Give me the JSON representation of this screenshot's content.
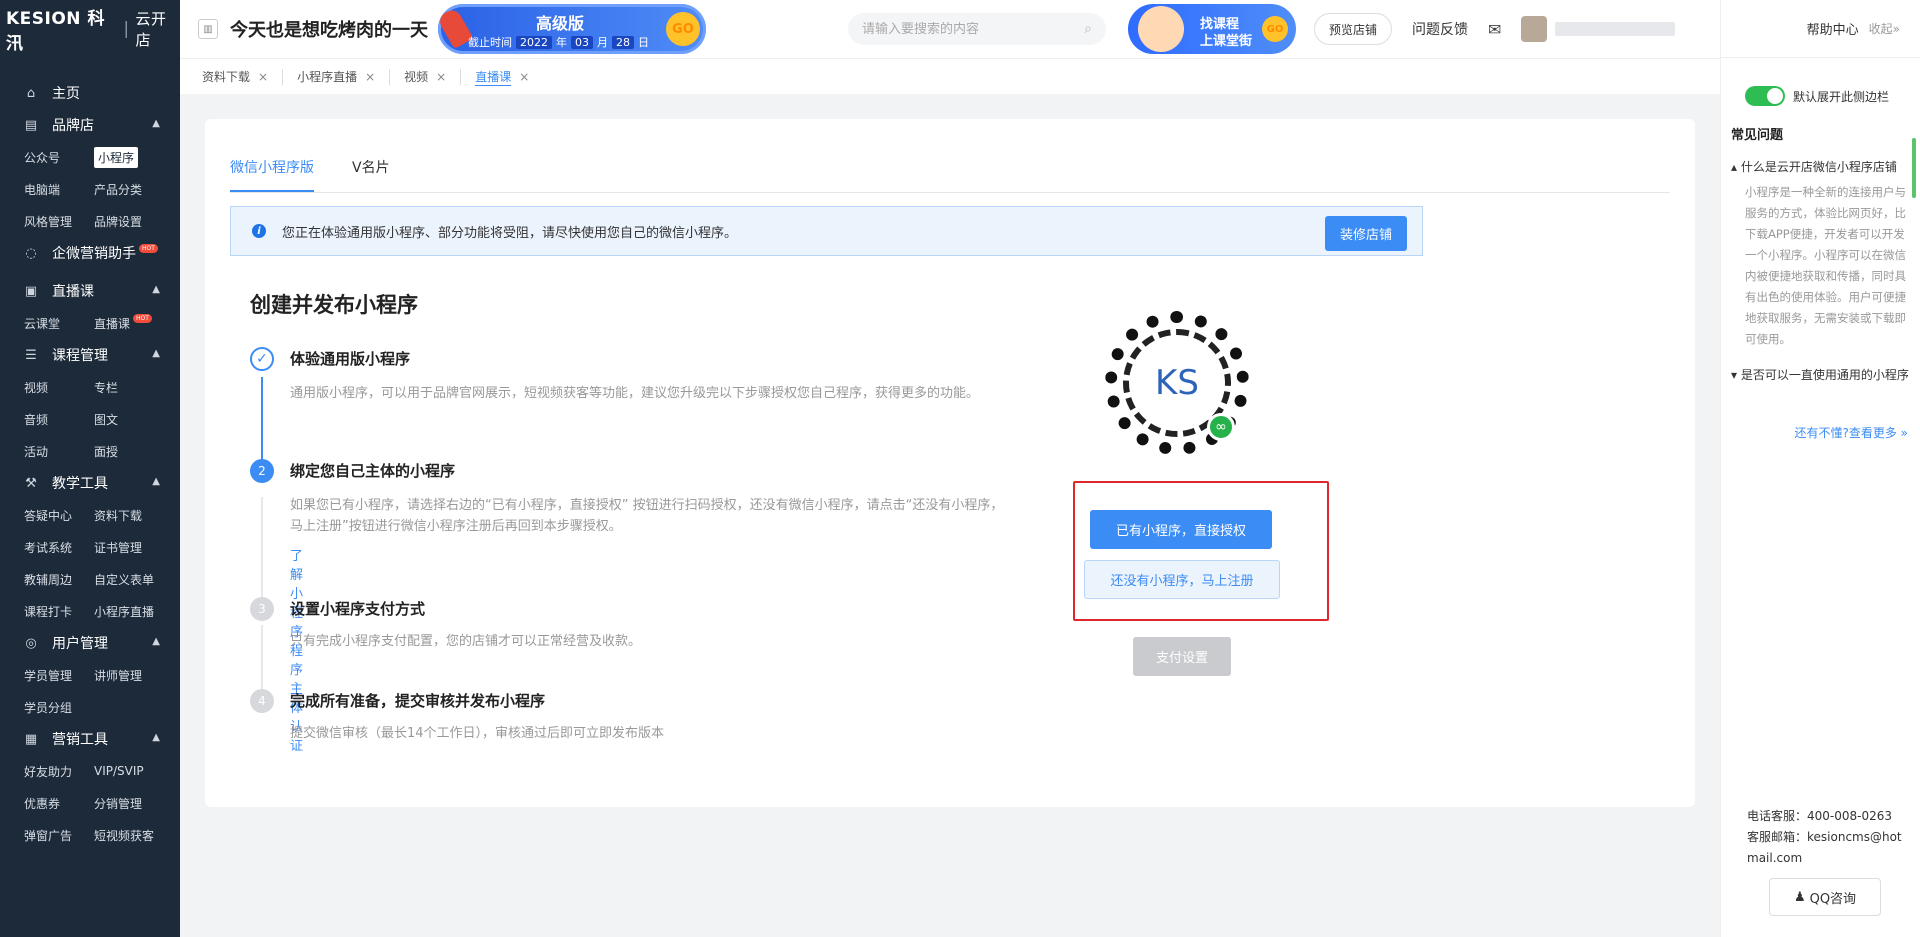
{
  "app": {
    "logo_brand": "KESION 科汛",
    "logo_sep": "|",
    "logo_sub": "云开店"
  },
  "sidebar": {
    "home": "主页",
    "sections": [
      {
        "label": "品牌店",
        "icon": "store-icon",
        "items": [
          "公众号",
          "小程序",
          "电脑端",
          "产品分类",
          "风格管理",
          "品牌设置"
        ]
      },
      {
        "label": "企微营销助手",
        "icon": "chat-icon",
        "hot": "HOT",
        "items": []
      },
      {
        "label": "直播课",
        "icon": "live-icon",
        "items": [
          "云课堂",
          "直播课"
        ],
        "hot_item": "HOT"
      },
      {
        "label": "课程管理",
        "icon": "course-icon",
        "items": [
          "视频",
          "专栏",
          "音频",
          "图文",
          "活动",
          "面授"
        ]
      },
      {
        "label": "教学工具",
        "icon": "tools-icon",
        "items": [
          "答疑中心",
          "资料下载",
          "考试系统",
          "证书管理",
          "教辅周边",
          "自定义表单",
          "课程打卡",
          "小程序直播"
        ]
      },
      {
        "label": "用户管理",
        "icon": "user-icon",
        "items": [
          "学员管理",
          "讲师管理",
          "学员分组"
        ]
      },
      {
        "label": "营销工具",
        "icon": "gift-icon",
        "items": [
          "好友助力",
          "VIP/SVIP",
          "优惠券",
          "分销管理",
          "弹窗广告",
          "短视频获客"
        ]
      }
    ]
  },
  "topbar": {
    "shop_name": "今天也是想吃烤肉的一天",
    "vip": {
      "title": "高级版",
      "deadline_label": "截止时间",
      "year": "2022",
      "year_unit": "年",
      "month": "03",
      "month_unit": "月",
      "day": "28",
      "day_unit": "日",
      "go": "GO"
    },
    "search_placeholder": "请输入要搜索的内容",
    "course_banner": {
      "line1": "找课程",
      "line2": "上课堂街",
      "go": "GO"
    },
    "preview_label": "预览店铺",
    "feedback_label": "问题反馈"
  },
  "tabs": [
    {
      "label": "资料下载",
      "active": false
    },
    {
      "label": "小程序直播",
      "active": false
    },
    {
      "label": "视频",
      "active": false
    },
    {
      "label": "直播课",
      "active": true
    }
  ],
  "main": {
    "inner_tabs": [
      "微信小程序版",
      "V名片"
    ],
    "notice_text": "您正在体验通用版小程序、部分功能将受阻，请尽快使用您自己的微信小程序。",
    "notice_button": "装修店铺",
    "title": "创建并发布小程序",
    "steps": [
      {
        "num": "✓",
        "title": "体验通用版小程序",
        "desc": "通用版小程序，可以用于品牌官网展示，短视频获客等功能，建议您升级完以下步骤授权您自己程序，获得更多的功能。"
      },
      {
        "num": "2",
        "title": "绑定您自己主体的小程序",
        "desc": "如果您已有小程序，请选择右边的“已有小程序，直接授权” 按钮进行扫码授权，还没有微信小程序，请点击“还没有小程序，马上注册”按钮进行微信小程序注册后再回到本步骤授权。",
        "link": "了解小程序程序主体认证"
      },
      {
        "num": "3",
        "title": "设置小程序支付方式",
        "desc": "只有完成小程序支付配置，您的店铺才可以正常经营及收款。"
      },
      {
        "num": "4",
        "title": "完成所有准备，提交审核并发布小程序",
        "desc": "提交微信审核（最长14个工作日），审核通过后即可立即发布版本"
      }
    ],
    "qr_text": "KS",
    "btn_authorize": "已有小程序，直接授权",
    "btn_register": "还没有小程序，马上注册",
    "btn_payment": "支付设置"
  },
  "help": {
    "title": "帮助中心",
    "collapse": "收起»",
    "toggle_label": "默认展开此侧边栏",
    "faq_title": "常见问题",
    "q1": "▴ 什么是云开店微信小程序店铺",
    "a1": "小程序是一种全新的连接用户与服务的方式，体验比网页好，比下载APP便捷，开发者可以开发一个小程序。小程序可以在微信内被便捷地获取和传播，同时具有出色的使用体验。用户可便捷地获取服务，无需安装或下载即可使用。",
    "q2": "▾ 是否可以一直使用通用的小程序",
    "more": "还有不懂?查看更多 »",
    "phone": "电话客服：400-008-0263",
    "email": "客服邮箱：kesioncms@hotmail.com",
    "qq": "QQ咨询"
  }
}
